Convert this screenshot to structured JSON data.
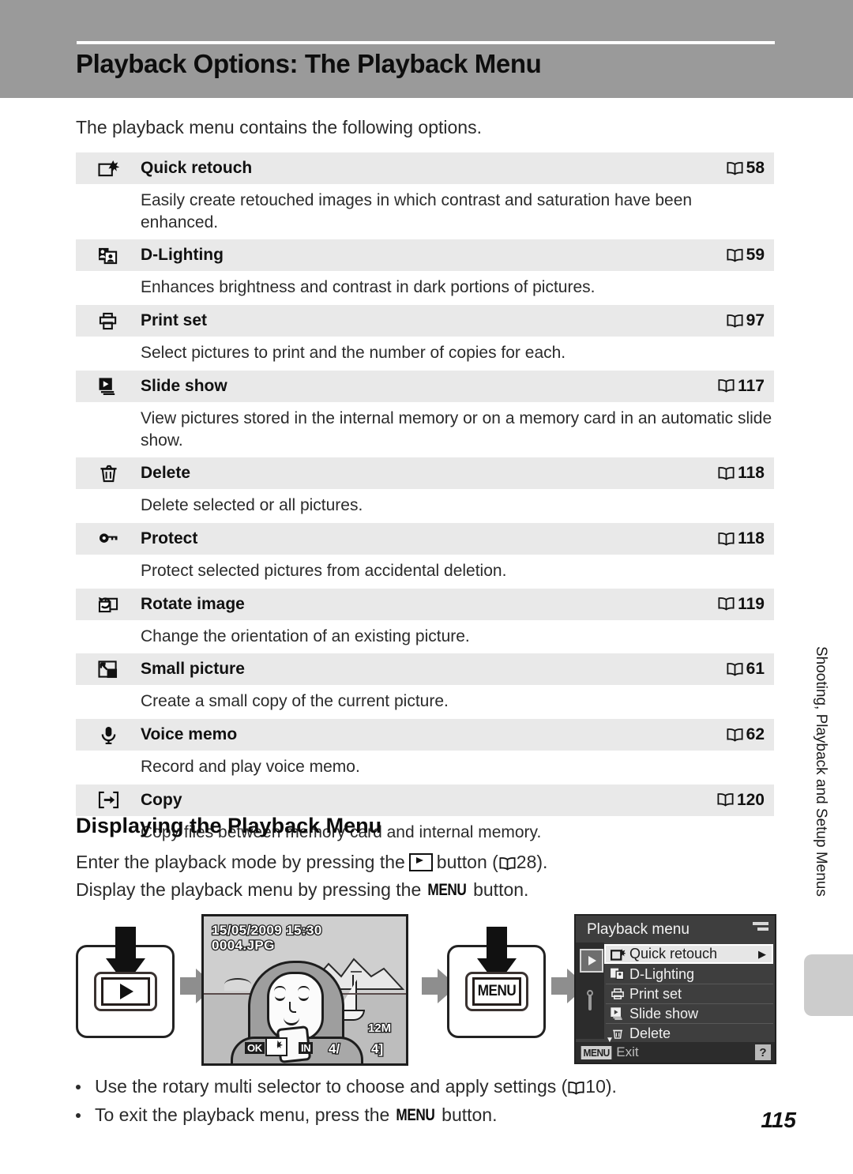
{
  "header": {
    "title": "Playback Options: The Playback Menu"
  },
  "intro": "The playback menu contains the following options.",
  "options": [
    {
      "icon": "quick-retouch-icon",
      "label": "Quick retouch",
      "ref": "58",
      "desc": "Easily create retouched images in which contrast and saturation have been enhanced."
    },
    {
      "icon": "d-lighting-icon",
      "label": "D-Lighting",
      "ref": "59",
      "desc": "Enhances brightness and contrast in dark portions of pictures."
    },
    {
      "icon": "print-set-icon",
      "label": "Print set",
      "ref": "97",
      "desc": "Select pictures to print and the number of copies for each."
    },
    {
      "icon": "slide-show-icon",
      "label": "Slide show",
      "ref": "117",
      "desc": "View pictures stored in the internal memory or on a memory card in an automatic slide show."
    },
    {
      "icon": "delete-icon",
      "label": "Delete",
      "ref": "118",
      "desc": "Delete selected or all pictures."
    },
    {
      "icon": "protect-key-icon",
      "label": "Protect",
      "ref": "118",
      "desc": "Protect selected pictures from accidental deletion."
    },
    {
      "icon": "rotate-image-icon",
      "label": "Rotate image",
      "ref": "119",
      "desc": "Change the orientation of an existing picture."
    },
    {
      "icon": "small-picture-icon",
      "label": "Small picture",
      "ref": "61",
      "desc": "Create a small copy of the current picture."
    },
    {
      "icon": "voice-memo-mic-icon",
      "label": "Voice memo",
      "ref": "62",
      "desc": "Record and play voice memo."
    },
    {
      "icon": "copy-icon",
      "label": "Copy",
      "ref": "120",
      "desc": "Copy files between memory card and internal memory."
    }
  ],
  "section": {
    "heading": "Displaying the Playback Menu",
    "line1_before": "Enter the playback mode by pressing the",
    "line1_after": "button (",
    "line1_ref": "28).",
    "line2_before": "Display the playback menu by pressing the",
    "line2_menu": "MENU",
    "line2_after": "button."
  },
  "illustration": {
    "playback_button_name": "playback-button",
    "menu_button_label": "MENU",
    "lcd_photo": {
      "datetime": "15/05/2009 15:30",
      "filename": "0004.JPG",
      "ok_badge": "OK",
      "memory_badge": "IN",
      "frame_counter_left": "4/",
      "frame_counter_right": "4]",
      "resolution_badge": "12M"
    },
    "lcd_menu": {
      "title": "Playback menu",
      "items": [
        {
          "label": "Quick retouch",
          "selected": true
        },
        {
          "label": "D-Lighting",
          "selected": false
        },
        {
          "label": "Print set",
          "selected": false
        },
        {
          "label": "Slide show",
          "selected": false
        },
        {
          "label": "Delete",
          "selected": false
        }
      ],
      "menu_chip": "MENU",
      "exit_label": "Exit",
      "help_label": "?"
    }
  },
  "bullets": [
    {
      "before": "Use the rotary multi selector to choose and apply settings (",
      "ref": "10)."
    },
    {
      "before": "To exit the playback menu, press the",
      "menu": "MENU",
      "after": "button."
    }
  ],
  "footer": {
    "page_number": "115",
    "side_tab_text": "Shooting, Playback and Setup Menus"
  },
  "colors": {
    "header_band": "#9a9a9a",
    "row_bg": "#e9e9e9",
    "side_tab": "#cccccc",
    "arrow_gray": "#8e8e8e"
  }
}
